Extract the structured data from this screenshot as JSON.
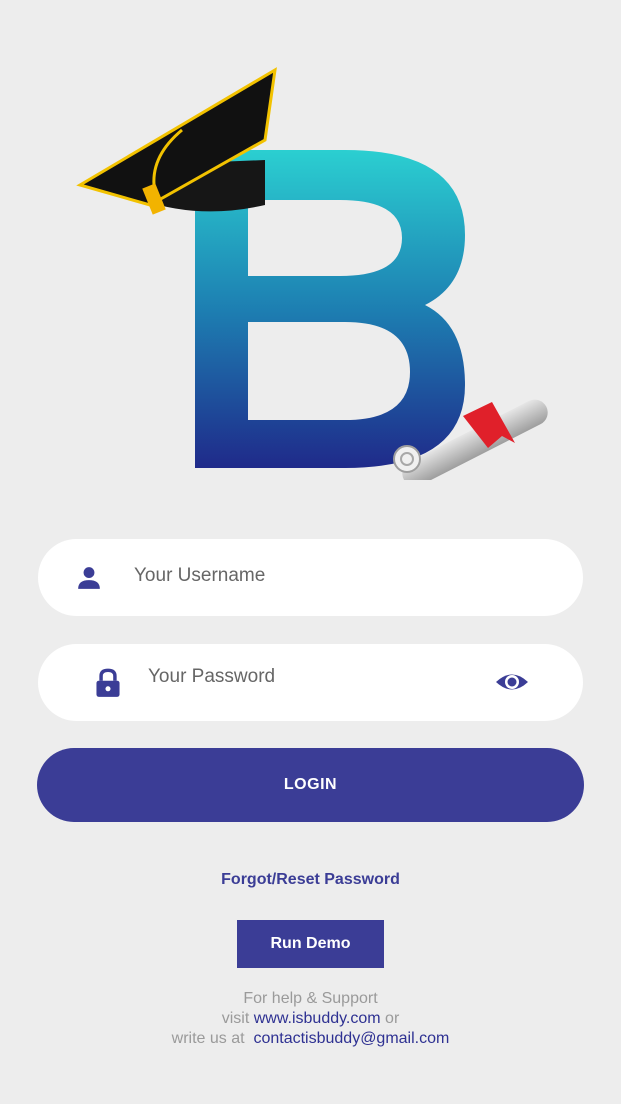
{
  "login_form": {
    "username_placeholder": "Your Username",
    "password_placeholder": "Your Password",
    "login_label": "LOGIN"
  },
  "links": {
    "forgot_password": "Forgot/Reset Password",
    "run_demo": "Run Demo"
  },
  "help": {
    "line1": "For help & Support",
    "visit_prefix": "visit",
    "website": "www.isbuddy.com",
    "or_text": "or",
    "write_prefix": "write us at",
    "email": "contactisbuddy@gmail.com"
  },
  "icons": {
    "logo": "graduation-cap-letter-b-logo",
    "username": "person-icon",
    "password": "lock-icon",
    "toggle": "eye-icon"
  },
  "colors": {
    "background": "#ededed",
    "primary": "#3b3d96",
    "link": "#2e3192",
    "muted_text": "#9a9a9a",
    "logo_gradient_top": "#2bcfd1",
    "logo_gradient_bottom": "#1f2a8a"
  }
}
